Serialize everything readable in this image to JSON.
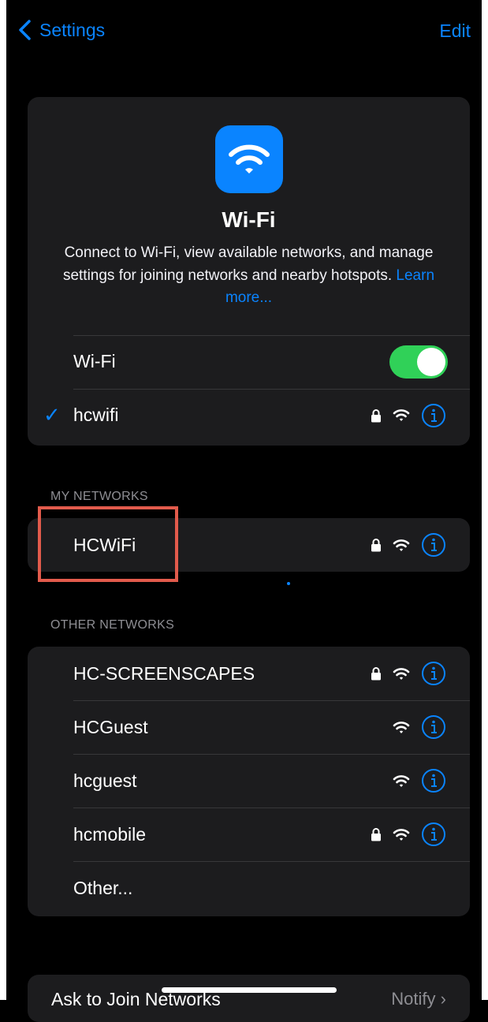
{
  "nav": {
    "back_label": "Settings",
    "edit_label": "Edit"
  },
  "hero": {
    "title": "Wi-Fi",
    "description": "Connect to Wi-Fi, view available networks, and manage settings for joining networks and nearby hotspots.",
    "learn_more": "Learn more..."
  },
  "wifi_toggle": {
    "label": "Wi-Fi",
    "on": true
  },
  "connected": {
    "name": "hcwifi",
    "secured": true
  },
  "my_networks": {
    "header": "MY NETWORKS",
    "items": [
      {
        "name": "HCWiFi",
        "secured": true
      }
    ]
  },
  "other_networks": {
    "header": "OTHER NETWORKS",
    "items": [
      {
        "name": "HC-SCREENSCAPES",
        "secured": true
      },
      {
        "name": "HCGuest",
        "secured": false
      },
      {
        "name": "hcguest",
        "secured": false
      },
      {
        "name": "hcmobile",
        "secured": true
      }
    ],
    "other_label": "Other..."
  },
  "ask_to_join": {
    "label": "Ask to Join Networks",
    "value": "Notify"
  },
  "colors": {
    "accent": "#0a84ff",
    "toggle_on": "#30d158",
    "highlight_box": "#e25b4c",
    "card_bg": "#1c1c1e"
  },
  "icons": {
    "back": "chevron-left-icon",
    "wifi": "wifi-icon",
    "lock": "lock-icon",
    "info": "info-icon",
    "check": "checkmark-icon"
  }
}
